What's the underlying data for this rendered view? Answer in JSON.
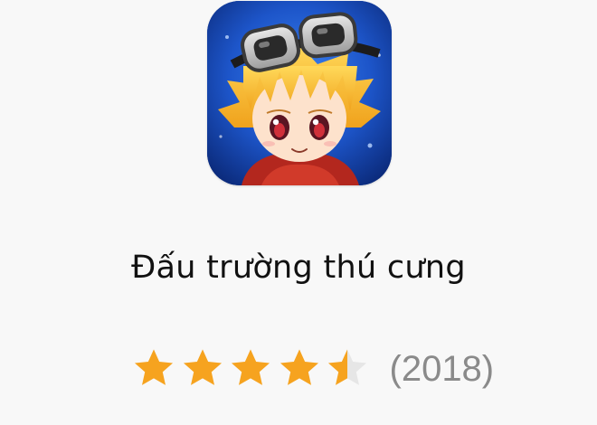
{
  "app": {
    "title": "Đấu trường thú cưng",
    "icon": "game-character-icon",
    "rating": {
      "value": 4.5,
      "max": 5,
      "count_text": "(2018)"
    }
  },
  "colors": {
    "background": "#f8f8f8",
    "star_filled": "#f6a31f",
    "star_empty": "#e6e6e6",
    "title": "#111111",
    "count": "#8a8a8a"
  }
}
